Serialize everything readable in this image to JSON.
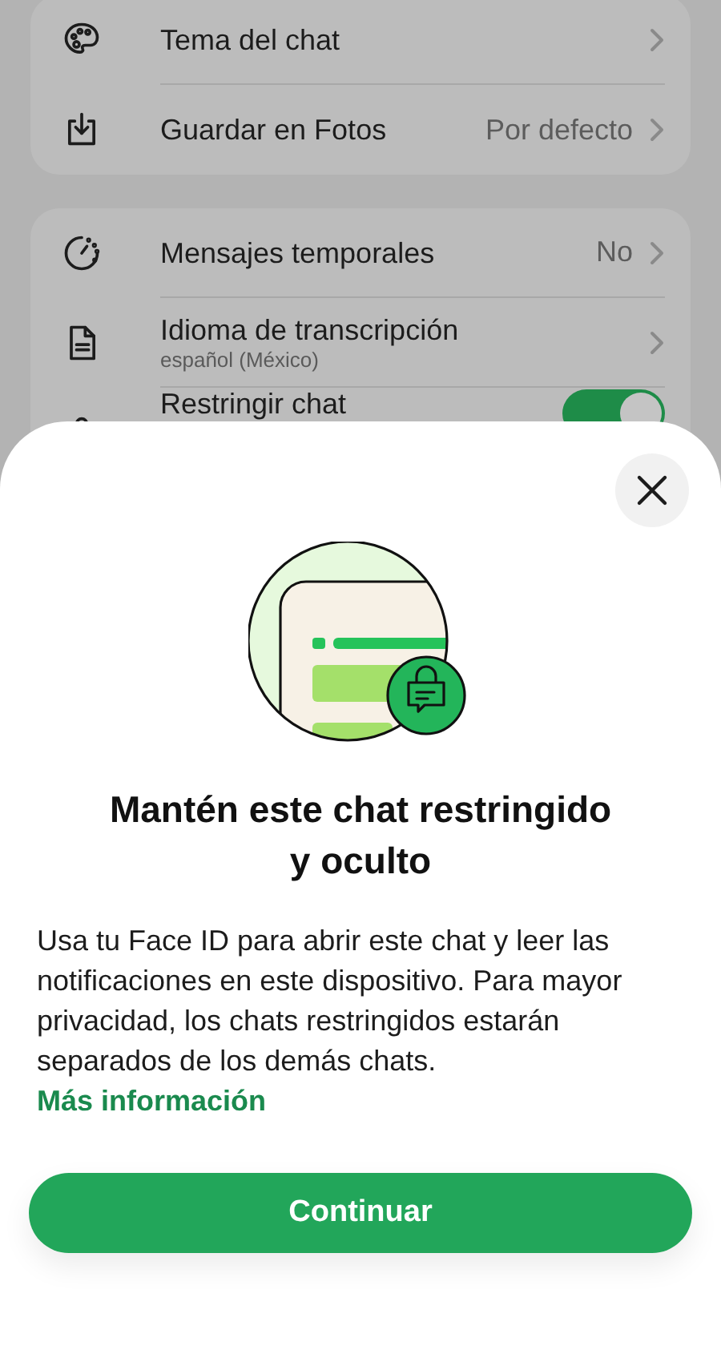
{
  "settings_groups": [
    {
      "items": [
        {
          "kind": "link",
          "label": "Tema del chat"
        },
        {
          "kind": "link",
          "label": "Guardar en Fotos",
          "value": "Por defecto"
        }
      ]
    },
    {
      "items": [
        {
          "kind": "link",
          "label": "Mensajes temporales",
          "value": "No"
        },
        {
          "kind": "link",
          "label": "Idioma de transcripción",
          "subtitle": "español (México)"
        },
        {
          "kind": "toggle",
          "label": "Restringir chat",
          "on": true
        }
      ]
    }
  ],
  "sheet": {
    "title_lines": [
      "Mantén este chat restringido",
      "y oculto"
    ],
    "body": "Usa tu Face ID para abrir este chat y leer las notificaciones en este dispositivo. Para mayor privacidad, los chats restringidos estarán separados de los demás chats.",
    "link": "Más información",
    "button": "Continuar"
  }
}
